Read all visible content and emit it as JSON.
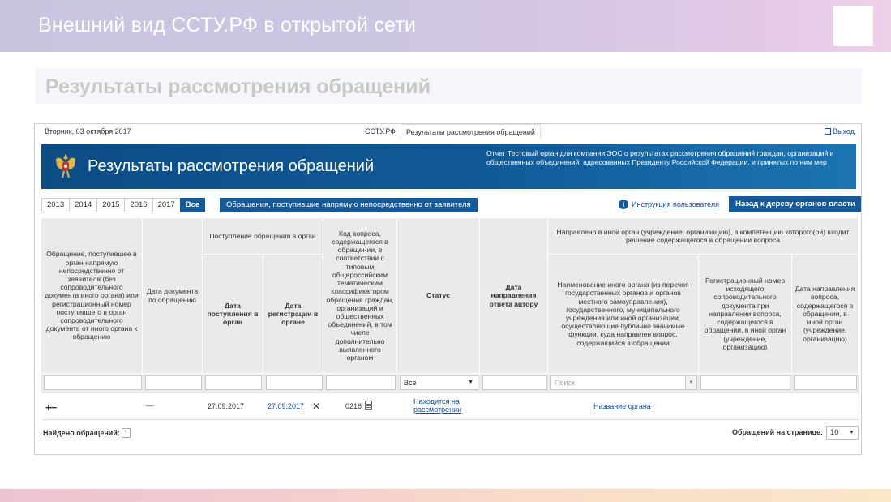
{
  "slide": {
    "title": "Внешний вид ССТУ.РФ в открытой сети",
    "subtitle": "Результаты рассмотрения обращений"
  },
  "topbar": {
    "date": "Вторник, 03 октября 2017",
    "breadcrumb_site": "ССТУ.РФ",
    "breadcrumb_page": "Результаты рассмотрения обращений",
    "logout": "Выход"
  },
  "banner": {
    "title": "Результаты рассмотрения обращений",
    "description": "Отчет Тестовый орган для компании ЭОС о результатах рассмотрения обращений граждан, организаций и общественных объединений, адресованных Президенту Российской Федерации, и принятых по ним мер"
  },
  "toolbar": {
    "years": [
      "2013",
      "2014",
      "2015",
      "2016",
      "2017",
      "Все"
    ],
    "active_year": "Все",
    "filter_button": "Обращения, поступившие напрямую непосредственно от заявителя",
    "help_link": "Инструкция пользователя",
    "back_button": "Назад к дереву органов власти"
  },
  "table": {
    "col_appeal": "Обращение, поступившее в орган напрямую непосредственно от заявителя (без сопроводительного документа иного органа) или регистрационный номер поступившего в орган сопроводительного документа от иного органа к обращению",
    "col_doc_date": "Дата документа по обращению",
    "group_receipt": "Поступление обращения в орган",
    "col_receipt_date": "Дата поступления в орган",
    "col_reg_date": "Дата регистрации в органе",
    "col_code": "Код вопроса, содержащегося в обращении, в соответствии с типовым общероссийским тематическим классификатором обращения граждан, организаций и общественных объединений, в том числе дополнительно выявленного органом",
    "col_status": "Статус",
    "col_reply_date": "Дата направления ответа автору",
    "group_redirect": "Направлено в иной орган (учреждение, организацию), в компетенцию которого(ой) входит решение содержащегося в обращении вопроса",
    "col_organ_name": "Наименование иного органа (из перечня государственных органов и органов местного самоуправления), государственного, муниципального учреждения или иной организации, осуществляющие публично значимые функции, куда направлен вопрос, содержащийся в обращении",
    "col_outgoing_reg": "Регистрационный номер исходящего сопроводительного документа при направлении вопроса, содержащегося в обращении, в иной орган (учреждение, организацию)",
    "col_redirect_date": "Дата направления вопроса, содержащегося в обращении, в иной орган (учреждение, организацию)",
    "filters": {
      "status_value": "Все",
      "organ_placeholder": "Поиск"
    },
    "rows": [
      {
        "expand": "+−",
        "doc_date": "—",
        "receipt_date": "27.09.2017",
        "reg_date": "27.09.2017",
        "remove": "✕",
        "code": "0216",
        "status": "Находится на рассмотрении",
        "organ": "Название органа"
      }
    ]
  },
  "footer": {
    "found_label": "Найдено обращений:",
    "found_count": "1",
    "per_page_label": "Обращений на странице:",
    "per_page_value": "10"
  }
}
